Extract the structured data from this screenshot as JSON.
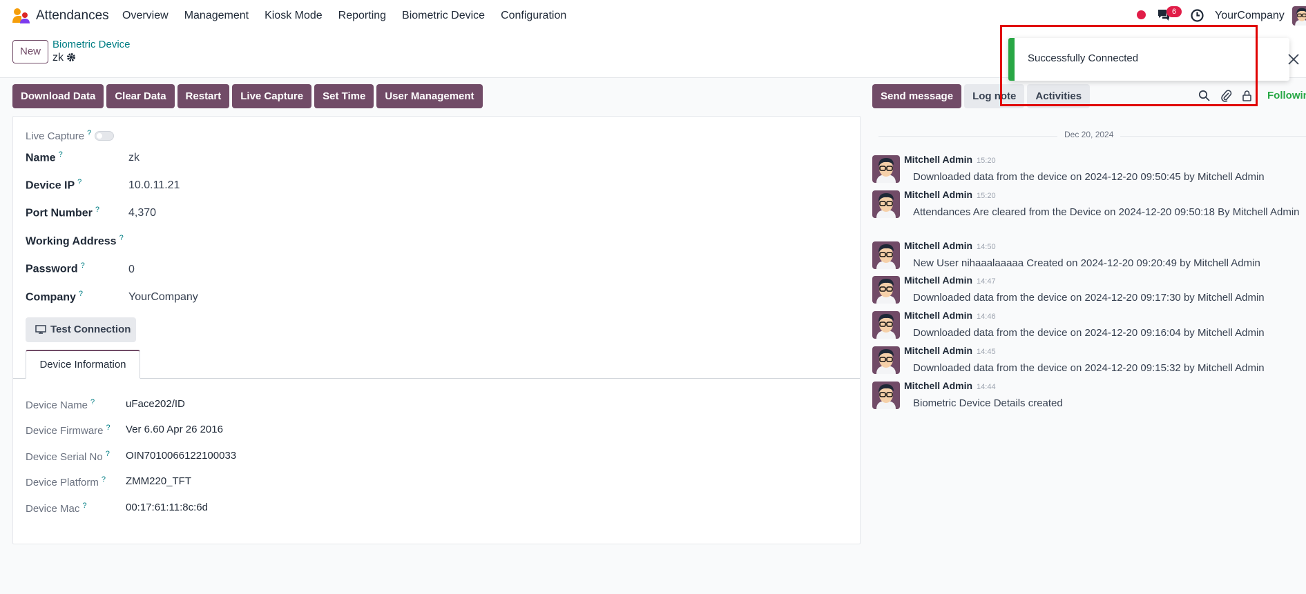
{
  "navbar": {
    "app_title": "Attendances",
    "menu": [
      "Overview",
      "Management",
      "Kiosk Mode",
      "Reporting",
      "Biometric Device",
      "Configuration"
    ],
    "chat_badge": "6",
    "company": "YourCompany",
    "icons": {
      "logo": "attendances-logo-icon",
      "record": "record-dot-icon",
      "chat": "chat-icon",
      "clock": "clock-icon"
    }
  },
  "control": {
    "new_label": "New",
    "breadcrumb": "Biometric Device",
    "record_name": "zk"
  },
  "actions": [
    "Download Data",
    "Clear Data",
    "Restart",
    "Live Capture",
    "Set Time",
    "User Management"
  ],
  "form": {
    "live_capture_label": "Live Capture",
    "live_capture_on": false,
    "help_mark": "?",
    "fields": [
      {
        "label": "Name",
        "value": "zk"
      },
      {
        "label": "Device IP",
        "value": "10.0.11.21"
      },
      {
        "label": "Port Number",
        "value": "4,370"
      },
      {
        "label": "Working Address",
        "value": ""
      },
      {
        "label": "Password",
        "value": "0"
      },
      {
        "label": "Company",
        "value": "YourCompany"
      }
    ],
    "test_connection_label": "Test Connection",
    "tab_label": "Device Information",
    "device_info": [
      {
        "label": "Device Name",
        "value": "uFace202/ID"
      },
      {
        "label": "Device Firmware",
        "value": "Ver 6.60 Apr 26 2016"
      },
      {
        "label": "Device Serial No",
        "value": "OIN7010066122100033"
      },
      {
        "label": "Device Platform",
        "value": "ZMM220_TFT"
      },
      {
        "label": "Device Mac",
        "value": "00:17:61:11:8c:6d"
      }
    ]
  },
  "chatter": {
    "send_message": "Send message",
    "log_note": "Log note",
    "activities": "Activities",
    "following": "Following",
    "date": "Dec 20, 2024",
    "messages": [
      {
        "author": "Mitchell Admin",
        "time": "15:20",
        "body": "Downloaded data from the device on 2024-12-20 09:50:45 by Mitchell Admin"
      },
      {
        "author": "Mitchell Admin",
        "time": "15:20",
        "body": "Attendances Are cleared from the Device on 2024-12-20 09:50:18 By Mitchell Admin"
      },
      {
        "author": "Mitchell Admin",
        "time": "14:50",
        "body": "New User nihaaalaaaaa Created on 2024-12-20 09:20:49 by Mitchell Admin"
      },
      {
        "author": "Mitchell Admin",
        "time": "14:47",
        "body": "Downloaded data from the device on 2024-12-20 09:17:30 by Mitchell Admin"
      },
      {
        "author": "Mitchell Admin",
        "time": "14:46",
        "body": "Downloaded data from the device on 2024-12-20 09:16:04 by Mitchell Admin"
      },
      {
        "author": "Mitchell Admin",
        "time": "14:45",
        "body": "Downloaded data from the device on 2024-12-20 09:15:32 by Mitchell Admin"
      },
      {
        "author": "Mitchell Admin",
        "time": "14:44",
        "body": "Biometric Device Details created"
      }
    ]
  },
  "toast": {
    "message": "Successfully Connected",
    "status_color": "#28a745"
  },
  "colors": {
    "brand": "#714b67",
    "link": "#017e84",
    "success": "#28a745",
    "highlight": "#e00000"
  }
}
